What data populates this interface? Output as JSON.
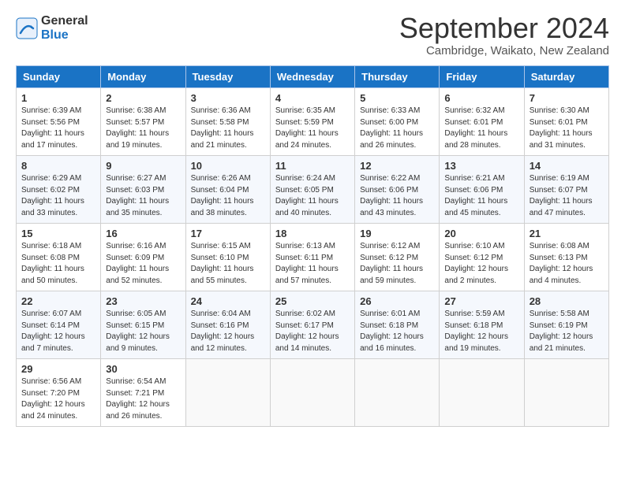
{
  "header": {
    "logo_general": "General",
    "logo_blue": "Blue",
    "month_title": "September 2024",
    "location": "Cambridge, Waikato, New Zealand"
  },
  "days_of_week": [
    "Sunday",
    "Monday",
    "Tuesday",
    "Wednesday",
    "Thursday",
    "Friday",
    "Saturday"
  ],
  "weeks": [
    [
      {
        "day": "1",
        "info": "Sunrise: 6:39 AM\nSunset: 5:56 PM\nDaylight: 11 hours\nand 17 minutes."
      },
      {
        "day": "2",
        "info": "Sunrise: 6:38 AM\nSunset: 5:57 PM\nDaylight: 11 hours\nand 19 minutes."
      },
      {
        "day": "3",
        "info": "Sunrise: 6:36 AM\nSunset: 5:58 PM\nDaylight: 11 hours\nand 21 minutes."
      },
      {
        "day": "4",
        "info": "Sunrise: 6:35 AM\nSunset: 5:59 PM\nDaylight: 11 hours\nand 24 minutes."
      },
      {
        "day": "5",
        "info": "Sunrise: 6:33 AM\nSunset: 6:00 PM\nDaylight: 11 hours\nand 26 minutes."
      },
      {
        "day": "6",
        "info": "Sunrise: 6:32 AM\nSunset: 6:01 PM\nDaylight: 11 hours\nand 28 minutes."
      },
      {
        "day": "7",
        "info": "Sunrise: 6:30 AM\nSunset: 6:01 PM\nDaylight: 11 hours\nand 31 minutes."
      }
    ],
    [
      {
        "day": "8",
        "info": "Sunrise: 6:29 AM\nSunset: 6:02 PM\nDaylight: 11 hours\nand 33 minutes."
      },
      {
        "day": "9",
        "info": "Sunrise: 6:27 AM\nSunset: 6:03 PM\nDaylight: 11 hours\nand 35 minutes."
      },
      {
        "day": "10",
        "info": "Sunrise: 6:26 AM\nSunset: 6:04 PM\nDaylight: 11 hours\nand 38 minutes."
      },
      {
        "day": "11",
        "info": "Sunrise: 6:24 AM\nSunset: 6:05 PM\nDaylight: 11 hours\nand 40 minutes."
      },
      {
        "day": "12",
        "info": "Sunrise: 6:22 AM\nSunset: 6:06 PM\nDaylight: 11 hours\nand 43 minutes."
      },
      {
        "day": "13",
        "info": "Sunrise: 6:21 AM\nSunset: 6:06 PM\nDaylight: 11 hours\nand 45 minutes."
      },
      {
        "day": "14",
        "info": "Sunrise: 6:19 AM\nSunset: 6:07 PM\nDaylight: 11 hours\nand 47 minutes."
      }
    ],
    [
      {
        "day": "15",
        "info": "Sunrise: 6:18 AM\nSunset: 6:08 PM\nDaylight: 11 hours\nand 50 minutes."
      },
      {
        "day": "16",
        "info": "Sunrise: 6:16 AM\nSunset: 6:09 PM\nDaylight: 11 hours\nand 52 minutes."
      },
      {
        "day": "17",
        "info": "Sunrise: 6:15 AM\nSunset: 6:10 PM\nDaylight: 11 hours\nand 55 minutes."
      },
      {
        "day": "18",
        "info": "Sunrise: 6:13 AM\nSunset: 6:11 PM\nDaylight: 11 hours\nand 57 minutes."
      },
      {
        "day": "19",
        "info": "Sunrise: 6:12 AM\nSunset: 6:12 PM\nDaylight: 11 hours\nand 59 minutes."
      },
      {
        "day": "20",
        "info": "Sunrise: 6:10 AM\nSunset: 6:12 PM\nDaylight: 12 hours\nand 2 minutes."
      },
      {
        "day": "21",
        "info": "Sunrise: 6:08 AM\nSunset: 6:13 PM\nDaylight: 12 hours\nand 4 minutes."
      }
    ],
    [
      {
        "day": "22",
        "info": "Sunrise: 6:07 AM\nSunset: 6:14 PM\nDaylight: 12 hours\nand 7 minutes."
      },
      {
        "day": "23",
        "info": "Sunrise: 6:05 AM\nSunset: 6:15 PM\nDaylight: 12 hours\nand 9 minutes."
      },
      {
        "day": "24",
        "info": "Sunrise: 6:04 AM\nSunset: 6:16 PM\nDaylight: 12 hours\nand 12 minutes."
      },
      {
        "day": "25",
        "info": "Sunrise: 6:02 AM\nSunset: 6:17 PM\nDaylight: 12 hours\nand 14 minutes."
      },
      {
        "day": "26",
        "info": "Sunrise: 6:01 AM\nSunset: 6:18 PM\nDaylight: 12 hours\nand 16 minutes."
      },
      {
        "day": "27",
        "info": "Sunrise: 5:59 AM\nSunset: 6:18 PM\nDaylight: 12 hours\nand 19 minutes."
      },
      {
        "day": "28",
        "info": "Sunrise: 5:58 AM\nSunset: 6:19 PM\nDaylight: 12 hours\nand 21 minutes."
      }
    ],
    [
      {
        "day": "29",
        "info": "Sunrise: 6:56 AM\nSunset: 7:20 PM\nDaylight: 12 hours\nand 24 minutes."
      },
      {
        "day": "30",
        "info": "Sunrise: 6:54 AM\nSunset: 7:21 PM\nDaylight: 12 hours\nand 26 minutes."
      },
      {
        "day": "",
        "info": ""
      },
      {
        "day": "",
        "info": ""
      },
      {
        "day": "",
        "info": ""
      },
      {
        "day": "",
        "info": ""
      },
      {
        "day": "",
        "info": ""
      }
    ]
  ]
}
